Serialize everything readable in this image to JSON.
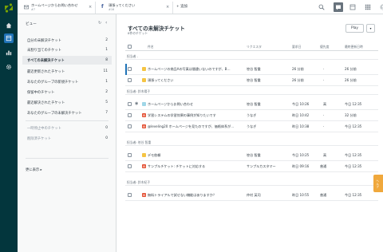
{
  "colors": {
    "rail": "#03363d",
    "accent": "#1f73b7",
    "pending": "#f5c443",
    "open": "#e34f32",
    "new": "#9fd6e7",
    "help": "#f0a83c"
  },
  "rail_icons": [
    "zendesk-logo",
    "home-icon",
    "views-icon",
    "reports-icon",
    "admin-gear-icon"
  ],
  "topbar": {
    "tabs": [
      {
        "title": "ホームページからお問い合わせ",
        "subtitle": "#7",
        "icon": "email-icon"
      },
      {
        "title": "頑張ってください",
        "subtitle": "#16",
        "icon": "facebook-icon"
      }
    ],
    "add_label": "+ 追加",
    "right_icons": [
      "search-icon",
      "conversations-icon",
      "apps-icon",
      "products-grid-icon",
      "user-avatar-icon"
    ]
  },
  "views": {
    "header": "ビュー",
    "items": [
      {
        "label": "自分の未解決チケット",
        "count": "2"
      },
      {
        "label": "未割り当てのチケット",
        "count": "1"
      },
      {
        "label": "すべての未解決チケット",
        "count": "8",
        "selected": true
      },
      {
        "label": "最近更新されたチケット",
        "count": "11"
      },
      {
        "label": "あなたのグループの新規チケット",
        "count": "1"
      },
      {
        "label": "保留中のチケット",
        "count": "2"
      },
      {
        "label": "最近解決されたチケット",
        "count": "5"
      },
      {
        "label": "あなたのグループの未解決チケット",
        "count": "7"
      },
      {
        "label": "一時停止中のチケット",
        "count": "0",
        "muted": true
      },
      {
        "label": "削除済チケット",
        "count": "0",
        "muted": true
      }
    ],
    "more_label": "更に表示 ▸"
  },
  "main": {
    "title": "すべての未解決チケット",
    "subtitle": "8件のチケット",
    "play_label": "Play",
    "dropdown_label": "▾",
    "columns": [
      "件名",
      "リクエスタ",
      "要求日",
      "優先度",
      "最終更新日時"
    ],
    "groups": [
      {
        "label": "担当者 -",
        "rows": [
          {
            "status": "pending",
            "status_letter": "",
            "subject": "ホームページの商品Aの写真は間違いないのですが、B…",
            "requester": "笹谷 智重",
            "requested": "26 分前",
            "priority": "-",
            "updated": "26 分前",
            "highlight": true
          },
          {
            "status": "pending",
            "status_letter": "",
            "subject": "頑張ってください",
            "requester": "笹谷 智重",
            "requested": "26 分前",
            "priority": "-",
            "updated": "26 分前"
          }
        ]
      },
      {
        "label": "担当者: 鈴木陽子",
        "rows": [
          {
            "status": "new",
            "status_letter": "",
            "subject": "ホームページからお問い合わせ",
            "requester": "笹谷 智重",
            "requested": "今日 10:26",
            "priority": "高",
            "updated": "今日 12:35",
            "eye": true
          },
          {
            "status": "open",
            "status_letter": "O",
            "subject": "学習システムの学習効果の事例が知りたいです",
            "requester": "うなぎ",
            "requested": "昨日 10:42",
            "priority": "-",
            "updated": "32 分前"
          },
          {
            "status": "open",
            "status_letter": "O",
            "subject": "@leveling20 ホームページを見たのですが、価格体系が…",
            "requester": "うなぎ",
            "requested": "昨日 10:38",
            "priority": "-",
            "updated": "今日 12:35"
          }
        ]
      },
      {
        "label": "担当者: 笹谷 智重",
        "rows": [
          {
            "status": "pending",
            "status_letter": "",
            "subject": "デモ依頼",
            "requester": "笹谷 智重",
            "requested": "今日 10:25",
            "priority": "高",
            "updated": "今日 12:35"
          },
          {
            "status": "open",
            "status_letter": "O",
            "subject": "サンプルチケット: チケットに対応する",
            "requester": "サンプルカスタマー",
            "requested": "昨日 09:16",
            "priority": "普通",
            "updated": "今日 12:35"
          }
        ]
      },
      {
        "label": "担当者: 鈴木紀子",
        "rows": [
          {
            "status": "open",
            "status_letter": "O",
            "subject": "無料トライアルで試せない機能はありますか？",
            "requester": "仲村 英司",
            "requested": "昨日 10:55",
            "priority": "普通",
            "updated": "今日 12:35"
          }
        ]
      }
    ]
  },
  "help_tab": "ヘルプ"
}
